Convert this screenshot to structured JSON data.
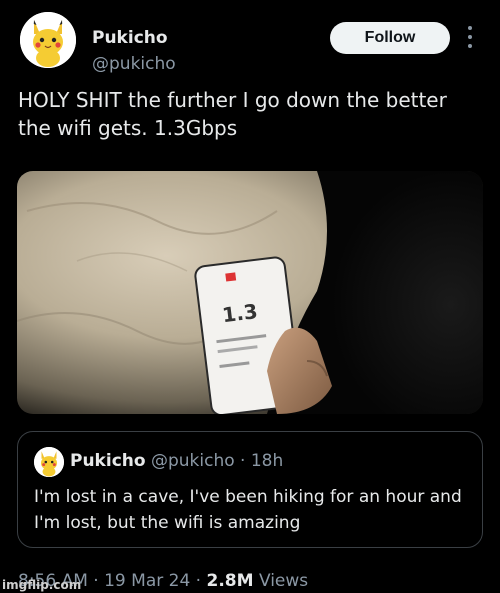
{
  "author": {
    "name": "Pukicho",
    "handle": "@pukicho",
    "avatar_icon": "pikachu-plush-avatar"
  },
  "follow_label": "Follow",
  "more_icon": "more-options-icon",
  "tweet": {
    "text": "HOLY SHIT the further I go down the better the wifi gets. 1.3Gbps"
  },
  "media": {
    "description_icon": "photo-cave-phone",
    "phone_speed": "1.3"
  },
  "quote": {
    "name": "Pukicho",
    "handle": "@pukicho",
    "separator": "·",
    "age": "18h",
    "text": "I'm lost in a cave, I've been hiking for an hour and I'm lost, but the wifi is amazing"
  },
  "footer": {
    "time": "8:56 AM",
    "sep1": "·",
    "date": "19 Mar 24",
    "sep2": "·",
    "views_count": "2.8M",
    "views_label": "Views"
  },
  "watermark": "imgflip.com",
  "colors": {
    "background": "#000000",
    "text_primary": "#e7e9ea",
    "text_secondary": "#8b98a5",
    "follow_bg": "#eff3f4",
    "border": "#3a3f44"
  }
}
